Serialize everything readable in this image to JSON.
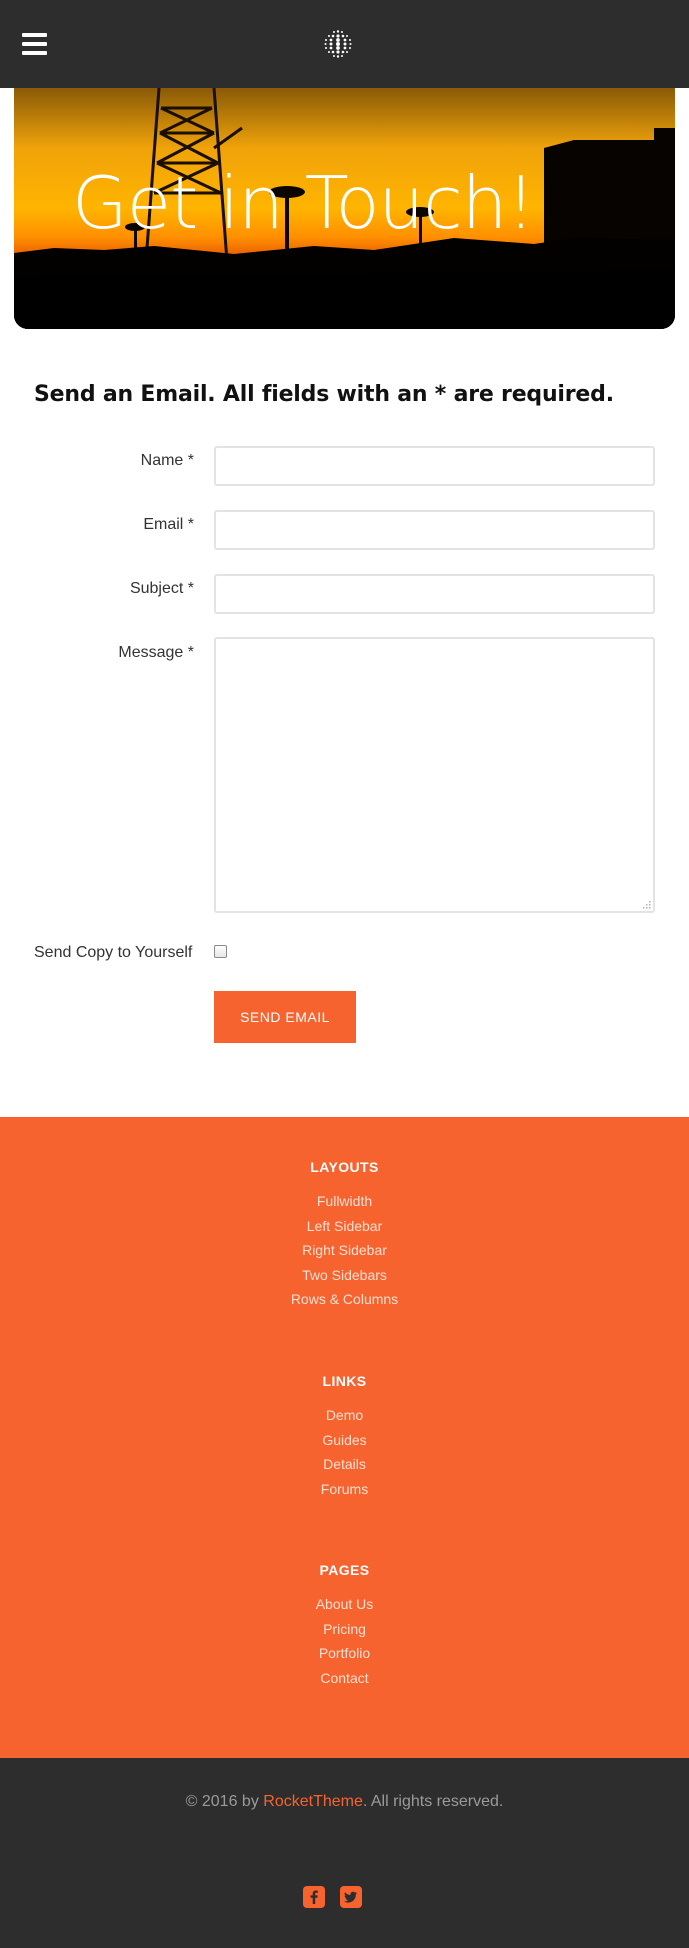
{
  "header": {
    "menu_icon": "hamburger-menu-icon",
    "logo_icon": "dotted-sphere-logo-icon"
  },
  "hero": {
    "title": "Get in Touch!"
  },
  "form": {
    "heading": "Send an Email. All fields with an * are required.",
    "fields": [
      {
        "label": "Name *",
        "value": ""
      },
      {
        "label": "Email *",
        "value": ""
      },
      {
        "label": "Subject *",
        "value": ""
      },
      {
        "label": "Message *",
        "value": ""
      }
    ],
    "copy_label": "Send Copy to Yourself",
    "copy_checked": false,
    "submit_label": "SEND EMAIL"
  },
  "footer": {
    "columns": [
      {
        "title": "LAYOUTS",
        "links": [
          "Fullwidth",
          "Left Sidebar",
          "Right Sidebar",
          "Two Sidebars",
          "Rows & Columns"
        ]
      },
      {
        "title": "LINKS",
        "links": [
          "Demo",
          "Guides",
          "Details",
          "Forums"
        ]
      },
      {
        "title": "PAGES",
        "links": [
          "About Us",
          "Pricing",
          "Portfolio",
          "Contact"
        ]
      }
    ],
    "copyright_prefix": "© 2016 by ",
    "copyright_brand": "RocketTheme",
    "copyright_suffix": ". All rights reserved.",
    "social": [
      {
        "icon": "facebook-icon"
      },
      {
        "icon": "twitter-icon"
      }
    ]
  },
  "colors": {
    "accent": "#f7632f",
    "dark": "#2d2d2d"
  }
}
